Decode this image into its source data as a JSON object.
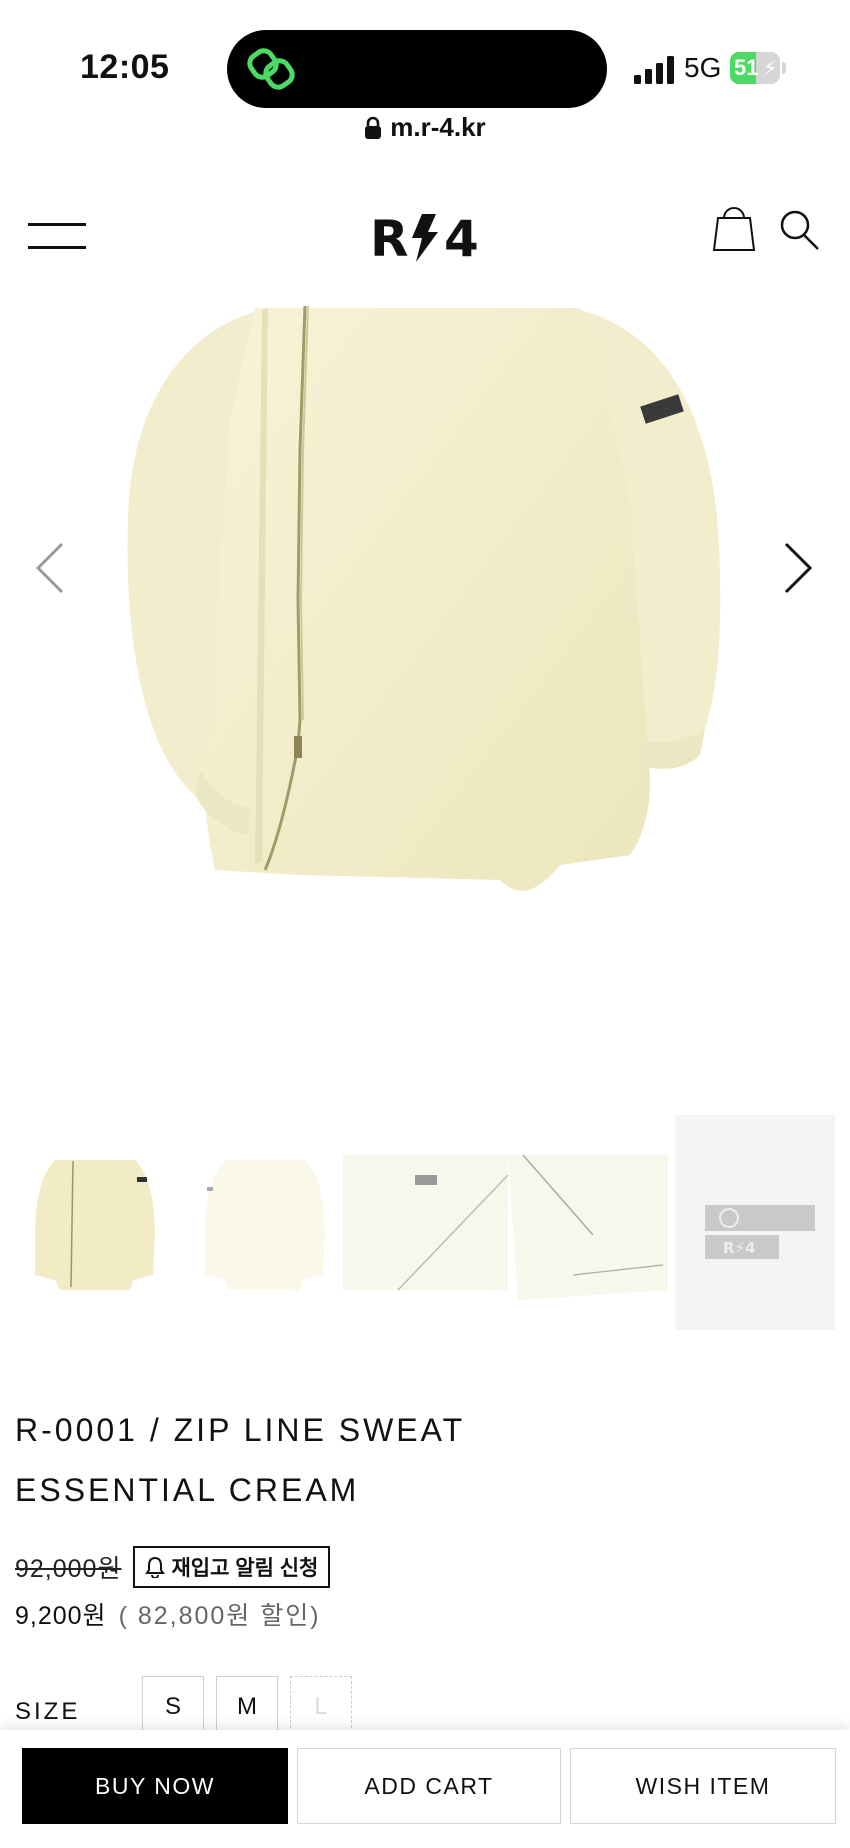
{
  "status_bar": {
    "time": "12:05",
    "network": "5G",
    "battery": "51",
    "battery_level": 0.51
  },
  "browser": {
    "url": "m.r-4.kr"
  },
  "header": {
    "logo_text": "R⚡4"
  },
  "gallery": {
    "thumb_logo_text": "R⚡4"
  },
  "product": {
    "title_line1": "R-0001 / ZIP LINE SWEAT",
    "title_line2": "ESSENTIAL CREAM",
    "original_price": "92,000원",
    "restock_label": "재입고 알림 신청",
    "sale_price": "9,200원",
    "discount_text": "( 82,800원 할인)"
  },
  "size": {
    "label": "SIZE",
    "options": [
      "S",
      "M",
      "L"
    ]
  },
  "actions": {
    "buy_now": "BUY NOW",
    "add_cart": "ADD CART",
    "wish_item": "WISH ITEM"
  }
}
